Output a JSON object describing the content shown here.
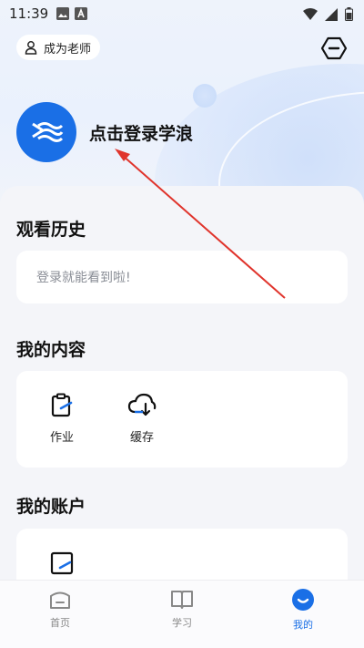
{
  "status_bar": {
    "time": "11:39"
  },
  "header": {
    "become_teacher_label": "成为老师"
  },
  "profile": {
    "login_prompt": "点击登录学浪"
  },
  "history": {
    "title": "观看历史",
    "empty_text": "登录就能看到啦!"
  },
  "my_content": {
    "title": "我的内容",
    "items": [
      {
        "label": "作业",
        "icon": "homework-icon"
      },
      {
        "label": "缓存",
        "icon": "cloud-download-icon"
      }
    ]
  },
  "my_account": {
    "title": "我的账户"
  },
  "tabbar": {
    "tabs": [
      {
        "label": "首页",
        "icon": "home-icon",
        "active": false
      },
      {
        "label": "学习",
        "icon": "book-icon",
        "active": false
      },
      {
        "label": "我的",
        "icon": "profile-smile-icon",
        "active": true
      }
    ]
  },
  "colors": {
    "accent": "#1a6fe6",
    "arrow": "#e0342c"
  }
}
